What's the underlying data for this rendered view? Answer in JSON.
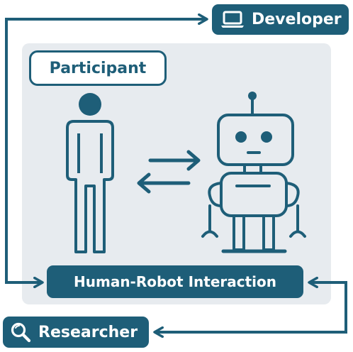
{
  "nodes": {
    "developer": {
      "label": "Developer",
      "icon": "laptop-icon"
    },
    "researcher": {
      "label": "Researcher",
      "icon": "magnifier-icon"
    },
    "participant": {
      "label": "Participant"
    },
    "interaction": {
      "label": "Human-Robot Interaction"
    }
  },
  "figures": {
    "human": "person-icon",
    "robot": "robot-icon",
    "exchange": "bidirectional-arrows-icon"
  },
  "colors": {
    "primary": "#1e5e78",
    "panel": "#e7ebef",
    "background": "#ffffff",
    "text_on_primary": "#ffffff"
  }
}
